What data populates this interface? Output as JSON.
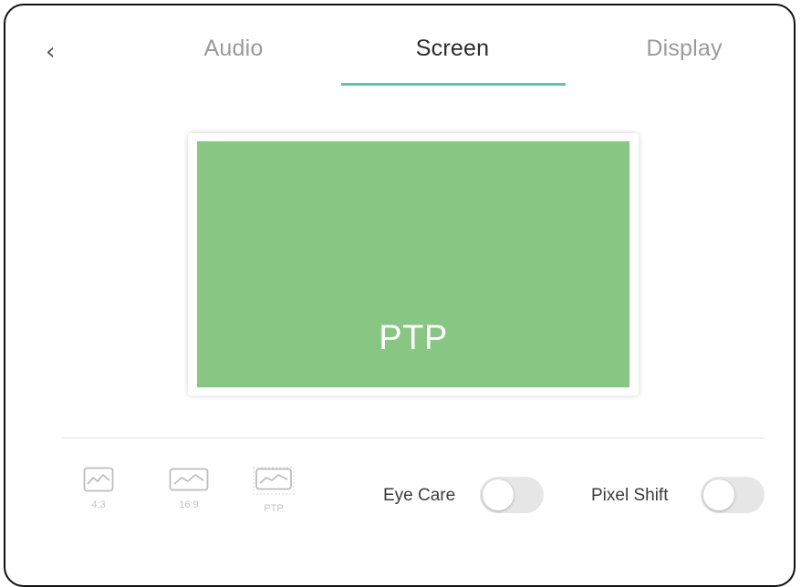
{
  "nav": {
    "back_icon": "chevron-left-icon",
    "back_glyph": "‹"
  },
  "tabs": [
    {
      "label": "Audio",
      "active": false
    },
    {
      "label": "Screen",
      "active": true
    },
    {
      "label": "Display",
      "active": false
    }
  ],
  "preview": {
    "label": "PTP",
    "color": "#87c683"
  },
  "aspect_ratios": [
    {
      "label": "4:3",
      "icon": "image-4-3-icon"
    },
    {
      "label": "16:9",
      "icon": "image-16-9-icon"
    },
    {
      "label": "PTP",
      "icon": "image-ptp-icon"
    }
  ],
  "toggles": {
    "eye_care": {
      "label": "Eye Care",
      "on": false
    },
    "pixel_shift": {
      "label": "Pixel Shift",
      "on": false
    }
  },
  "colors": {
    "accent": "#5cc6b6",
    "toggle_off": "#e6e6e6"
  }
}
